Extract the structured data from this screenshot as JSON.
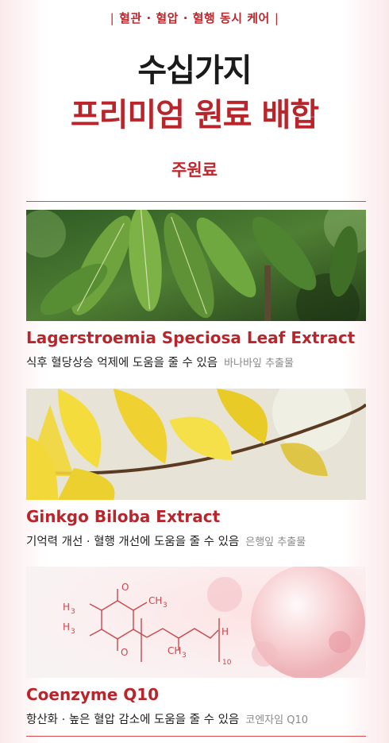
{
  "header": {
    "tagline": "혈관 · 혈압 · 혈행 동시 케어",
    "title_line1": "수십가지",
    "title_line2": "프리미엄 원료 배합",
    "section_title": "주원료"
  },
  "ingredients": [
    {
      "name": "Lagerstroemia Speciosa Leaf Extract",
      "description": "식후 혈당상승 억제에 도움을 줄 수 있음",
      "source": "바나바잎 추출물"
    },
    {
      "name": "Ginkgo Biloba Extract",
      "description": "기억력 개선 · 혈행 개선에 도움을 줄 수 있음",
      "source": "은행잎 추출물"
    },
    {
      "name": "Coenzyme Q10",
      "description": "항산화 · 높은 혈압 감소에 도움을 줄 수 있음",
      "source": "코엔자임 Q10"
    }
  ],
  "formula": {
    "ch3": "CH",
    "h3c": "H",
    "three": "3",
    "o": "O",
    "h": "H",
    "ten": "10"
  },
  "colors": {
    "accent": "#c0272d",
    "title_dark": "#1a1a1a"
  }
}
